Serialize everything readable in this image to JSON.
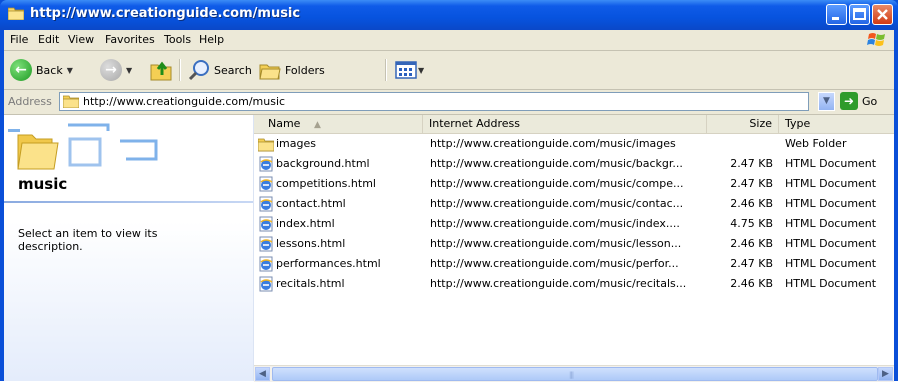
{
  "window": {
    "title": "http://www.creationguide.com/music"
  },
  "menubar": {
    "items": [
      "File",
      "Edit",
      "View",
      "Favorites",
      "Tools",
      "Help"
    ]
  },
  "toolbar": {
    "back_label": "Back",
    "search_label": "Search",
    "folders_label": "Folders"
  },
  "addressbar": {
    "label": "Address",
    "value": "http://www.creationguide.com/music",
    "go_label": "Go"
  },
  "leftpane": {
    "title": "music",
    "description": "Select an item to view its description."
  },
  "list": {
    "columns": [
      "Name",
      "Internet Address",
      "Size",
      "Type"
    ],
    "sort_indicator": "▲",
    "rows": [
      {
        "icon": "folder-icon",
        "name": "images",
        "address": "http://www.creationguide.com/music/images",
        "size": "",
        "type": "Web Folder"
      },
      {
        "icon": "html-file-icon",
        "name": "background.html",
        "address": "http://www.creationguide.com/music/backgr...",
        "size": "2.47 KB",
        "type": "HTML Document"
      },
      {
        "icon": "html-file-icon",
        "name": "competitions.html",
        "address": "http://www.creationguide.com/music/compe...",
        "size": "2.47 KB",
        "type": "HTML Document"
      },
      {
        "icon": "html-file-icon",
        "name": "contact.html",
        "address": "http://www.creationguide.com/music/contac...",
        "size": "2.46 KB",
        "type": "HTML Document"
      },
      {
        "icon": "html-file-icon",
        "name": "index.html",
        "address": "http://www.creationguide.com/music/index....",
        "size": "4.75 KB",
        "type": "HTML Document"
      },
      {
        "icon": "html-file-icon",
        "name": "lessons.html",
        "address": "http://www.creationguide.com/music/lesson...",
        "size": "2.46 KB",
        "type": "HTML Document"
      },
      {
        "icon": "html-file-icon",
        "name": "performances.html",
        "address": "http://www.creationguide.com/music/perfor...",
        "size": "2.47 KB",
        "type": "HTML Document"
      },
      {
        "icon": "html-file-icon",
        "name": "recitals.html",
        "address": "http://www.creationguide.com/music/recitals...",
        "size": "2.46 KB",
        "type": "HTML Document"
      }
    ]
  },
  "colors": {
    "titlebar": "#0a4fd8",
    "frame": "#ece9d8",
    "close_button": "#d23b14"
  }
}
